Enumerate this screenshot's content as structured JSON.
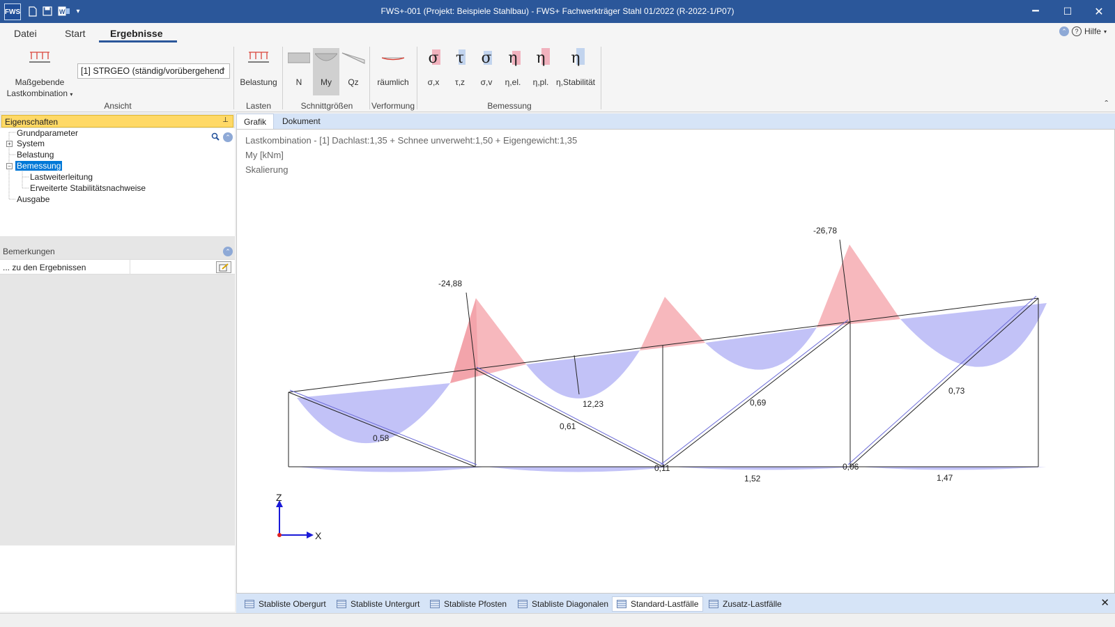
{
  "window": {
    "title": "FWS+-001 (Projekt: Beispiele Stahlbau) - FWS+ Fachwerkträger Stahl 01/2022 (R-2022-1/P07)",
    "logo": "FWS",
    "minimize": "🗕",
    "maximize": "☐",
    "close": "✕",
    "quick_access_menu": "▾"
  },
  "menu": {
    "tabs": [
      "Datei",
      "Start",
      "Ergebnisse"
    ],
    "active": "Ergebnisse",
    "help": "Hilfe",
    "help_arrow": "▾"
  },
  "ribbon": {
    "ansicht": {
      "button_line1": "Maßgebende",
      "button_line2": "Lastkombination",
      "dropdown_arrow": "▾",
      "combo_value": "[1] STRGEO (ständig/vorübergehend",
      "group": "Ansicht"
    },
    "lasten": {
      "button": "Belastung",
      "group": "Lasten"
    },
    "schnittgroessen": {
      "buttons": [
        "N",
        "My",
        "Qz"
      ],
      "active": "My",
      "group": "Schnittgrößen"
    },
    "verformung": {
      "button": "räumlich",
      "group": "Verformung"
    },
    "bemessung": {
      "buttons": [
        {
          "glyph": "σ",
          "label": "σ,x",
          "color": "#e8a0b0"
        },
        {
          "glyph": "τ",
          "label": "τ,z",
          "color": "#a8c4e8"
        },
        {
          "glyph": "σ",
          "label": "σ,v",
          "color": "#a8c4e8"
        },
        {
          "glyph": "η",
          "label": "η,el.",
          "color": "#e8a0b0"
        },
        {
          "glyph": "η",
          "label": "η,pl.",
          "color": "#e8a0b0"
        },
        {
          "glyph": "η",
          "label": "η,Stabilität",
          "color": "#a8c4e8"
        }
      ],
      "group": "Bemessung"
    },
    "collapse": "ˆ"
  },
  "left_panel": {
    "header": "Eigenschaften",
    "pin": "📌",
    "tree": {
      "grundparameter": "Grundparameter",
      "system": "System",
      "belastung": "Belastung",
      "bemessung": "Bemessung",
      "lastweiterleitung": "Lastweiterleitung",
      "stabilitaet": "Erweiterte Stabilitätsnachweise",
      "ausgabe": "Ausgabe"
    },
    "bemerkungen": {
      "header": "Bemerkungen",
      "row_label": "... zu den Ergebnissen"
    }
  },
  "doc_tabs": [
    "Grafik",
    "Dokument"
  ],
  "graphic": {
    "lastkombination": "Lastkombination - [1] Dachlast:1,35 + Schnee unverweht:1,50 + Eigengewicht:1,35",
    "quantity": "My [kNm]",
    "scaling": "Skalierung",
    "axis_x": "X",
    "axis_z": "Z",
    "fill_negative": "#f7b8bd",
    "fill_positive": "#c2c2f7",
    "value_labels": [
      "-24,88",
      "-26,78",
      "12,23",
      "0,69",
      "0,73",
      "0,58",
      "0,61",
      "0,11",
      "0,06",
      "1,52",
      "1,47"
    ]
  },
  "bottom_tabs": {
    "items": [
      "Stabliste Obergurt",
      "Stabliste Untergurt",
      "Stabliste Pfosten",
      "Stabliste Diagonalen",
      "Standard-Lastfälle",
      "Zusatz-Lastfälle"
    ],
    "active": "Standard-Lastfälle",
    "close": "✕"
  }
}
